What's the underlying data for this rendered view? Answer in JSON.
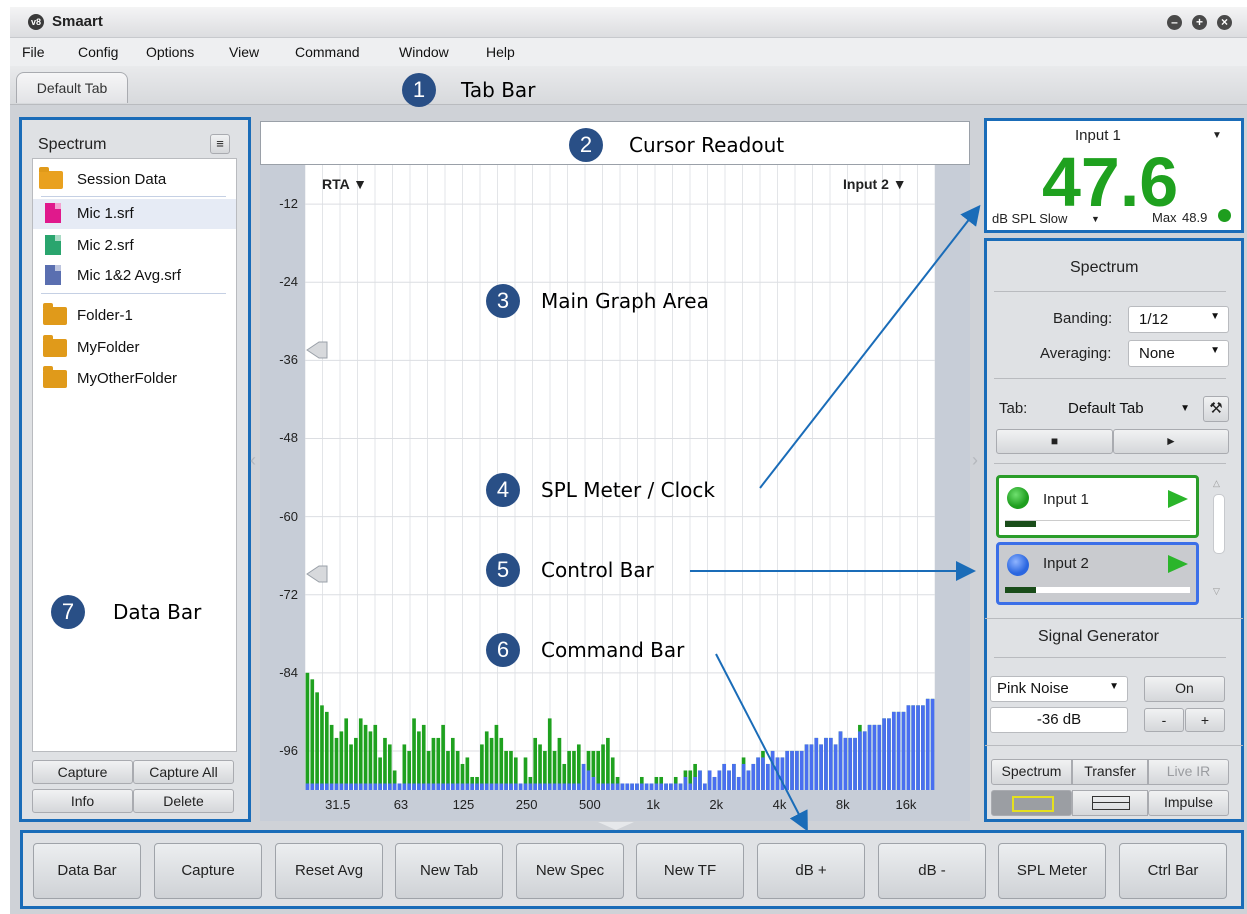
{
  "app": {
    "title": "Smaart",
    "logo_text": "v8"
  },
  "menu": [
    "File",
    "Config",
    "Options",
    "View",
    "Command",
    "Window",
    "Help"
  ],
  "tabs": [
    {
      "label": "Default Tab"
    }
  ],
  "callouts": [
    {
      "num": "1",
      "label": "Tab Bar"
    },
    {
      "num": "2",
      "label": "Cursor Readout"
    },
    {
      "num": "3",
      "label": "Main Graph Area"
    },
    {
      "num": "4",
      "label": "SPL Meter / Clock"
    },
    {
      "num": "5",
      "label": "Control Bar"
    },
    {
      "num": "6",
      "label": "Command Bar"
    },
    {
      "num": "7",
      "label": "Data Bar"
    }
  ],
  "data_bar": {
    "title": "Spectrum",
    "items": [
      {
        "label": "Session Data",
        "type": "folder-open"
      },
      {
        "label": "Mic 1.srf",
        "type": "file",
        "color": "#e0198c"
      },
      {
        "label": "Mic 2.srf",
        "type": "file",
        "color": "#2aa56e"
      },
      {
        "label": "Mic 1&2 Avg.srf",
        "type": "file",
        "color": "#5a6fb0"
      },
      {
        "label": "Folder-1",
        "type": "folder"
      },
      {
        "label": "MyFolder",
        "type": "folder"
      },
      {
        "label": "MyOtherFolder",
        "type": "folder"
      }
    ],
    "buttons": {
      "capture": "Capture",
      "capture_all": "Capture All",
      "info": "Info",
      "delete": "Delete"
    }
  },
  "graph": {
    "left_label": "RTA ▼",
    "right_label": "Input 2 ▼",
    "colors": {
      "input1": "#1fa11f",
      "input2": "#4a6ff0"
    }
  },
  "chart_data": {
    "type": "bar",
    "x_scale": "log",
    "xlim": [
      22,
      22000
    ],
    "ylim": [
      -102,
      -6
    ],
    "y_ticks": [
      -12,
      -24,
      -36,
      -48,
      -60,
      -72,
      -84,
      -96
    ],
    "x_ticks": [
      "31.5",
      "63",
      "125",
      "250",
      "500",
      "1k",
      "2k",
      "4k",
      "8k",
      "16k"
    ],
    "x_tick_values": [
      31.5,
      63,
      125,
      250,
      500,
      1000,
      2000,
      4000,
      8000,
      16000
    ],
    "series": [
      {
        "name": "Input 1",
        "color": "#1fa11f",
        "values": [
          -84,
          -85,
          -87,
          -89,
          -90,
          -92,
          -94,
          -93,
          -91,
          -95,
          -94,
          -91,
          -92,
          -93,
          -92,
          -97,
          -94,
          -95,
          -99,
          -101,
          -95,
          -96,
          -91,
          -93,
          -92,
          -96,
          -94,
          -94,
          -92,
          -96,
          -94,
          -96,
          -98,
          -97,
          -100,
          -100,
          -95,
          -93,
          -94,
          -92,
          -94,
          -96,
          -96,
          -97,
          -101,
          -97,
          -100,
          -94,
          -95,
          -96,
          -91,
          -96,
          -94,
          -98,
          -96,
          -96,
          -95,
          -98,
          -96,
          -96,
          -96,
          -95,
          -94,
          -97,
          -100,
          -101,
          -101,
          -101,
          -101,
          -100,
          -101,
          -101,
          -100,
          -100,
          -101,
          -101,
          -100,
          -101,
          -99,
          -99,
          -98,
          -99,
          -101,
          -99,
          -100,
          -99,
          -98,
          -99,
          -98,
          -100,
          -97,
          -99,
          -98,
          -97,
          -96,
          -98,
          -96,
          -97,
          -97,
          -96,
          -96,
          -96,
          -96,
          -95,
          -95,
          -94,
          -95,
          -94,
          -94,
          -95,
          -93,
          -94,
          -94,
          -94,
          -92,
          -93,
          -92,
          -92,
          -92,
          -91,
          -91,
          -90,
          -90,
          -90,
          -89,
          -89,
          -89,
          -89,
          -88,
          -88
        ]
      },
      {
        "name": "Input 2",
        "color": "#4a6ff0",
        "values": [
          -101,
          -101,
          -101,
          -101,
          -101,
          -101,
          -101,
          -101,
          -101,
          -101,
          -101,
          -101,
          -101,
          -101,
          -101,
          -101,
          -101,
          -101,
          -101,
          -101,
          -101,
          -101,
          -101,
          -101,
          -101,
          -101,
          -101,
          -101,
          -101,
          -101,
          -101,
          -101,
          -101,
          -101,
          -101,
          -101,
          -101,
          -101,
          -101,
          -101,
          -101,
          -101,
          -101,
          -101,
          -101,
          -101,
          -101,
          -101,
          -101,
          -101,
          -101,
          -101,
          -101,
          -101,
          -101,
          -101,
          -101,
          -98,
          -99,
          -100,
          -101,
          -101,
          -101,
          -101,
          -101,
          -101,
          -101,
          -101,
          -101,
          -101,
          -101,
          -101,
          -101,
          -101,
          -101,
          -101,
          -101,
          -101,
          -100,
          -101,
          -100,
          -99,
          -101,
          -99,
          -100,
          -99,
          -98,
          -99,
          -98,
          -100,
          -98,
          -99,
          -98,
          -97,
          -97,
          -98,
          -96,
          -97,
          -97,
          -96,
          -96,
          -96,
          -96,
          -95,
          -95,
          -94,
          -95,
          -94,
          -94,
          -95,
          -93,
          -94,
          -94,
          -94,
          -93,
          -93,
          -92,
          -92,
          -92,
          -91,
          -91,
          -90,
          -90,
          -90,
          -89,
          -89,
          -89,
          -89,
          -88,
          -88
        ]
      }
    ]
  },
  "spl_meter": {
    "input": "Input 1",
    "value": "47.6",
    "mode": "dB SPL Slow",
    "max_label": "Max",
    "max_value": "48.9",
    "color": "#1fa11f"
  },
  "control_bar": {
    "section_title": "Spectrum",
    "banding_label": "Banding:",
    "banding_value": "1/12",
    "averaging_label": "Averaging:",
    "averaging_value": "None",
    "tab_label": "Tab:",
    "tab_value": "Default Tab",
    "inputs": [
      {
        "name": "Input 1",
        "dot": "#1e9e1e",
        "border": "#2a9d2a",
        "level": 0.17
      },
      {
        "name": "Input 2",
        "dot": "#2a66e0",
        "border": "#3b6fe8",
        "level": 0.17
      }
    ],
    "siggen_title": "Signal Generator",
    "siggen_type": "Pink Noise",
    "siggen_on": "On",
    "siggen_level": "-36 dB",
    "minus": "-",
    "plus": "+",
    "modes": [
      "Spectrum",
      "Transfer",
      "Live IR"
    ],
    "impulse": "Impulse"
  },
  "command_bar": [
    "Data Bar",
    "Capture",
    "Reset Avg",
    "New Tab",
    "New Spec",
    "New TF",
    "dB +",
    "dB -",
    "SPL Meter",
    "Ctrl Bar"
  ]
}
